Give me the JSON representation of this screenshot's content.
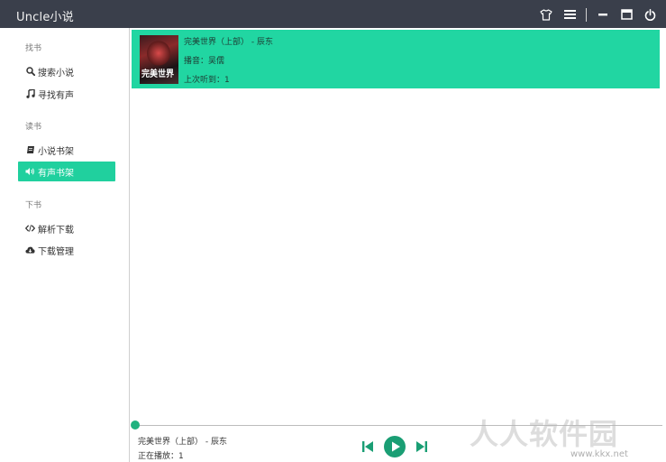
{
  "app": {
    "title": "Uncle小说"
  },
  "window_controls": [
    {
      "icon": "shirt-icon"
    },
    {
      "icon": "menu-icon"
    },
    {
      "icon": "minimize-icon"
    },
    {
      "icon": "maximize-icon"
    },
    {
      "icon": "power-icon"
    }
  ],
  "sidebar": {
    "groups": [
      {
        "label": "找书",
        "items": [
          {
            "label": "搜索小说",
            "icon": "search-icon"
          },
          {
            "label": "寻找有声",
            "icon": "music-note-icon"
          }
        ]
      },
      {
        "label": "读书",
        "items": [
          {
            "label": "小说书架",
            "icon": "book-icon"
          },
          {
            "label": "有声书架",
            "icon": "volume-icon",
            "active": true
          }
        ]
      },
      {
        "label": "下书",
        "items": [
          {
            "label": "解析下载",
            "icon": "code-icon"
          },
          {
            "label": "下载管理",
            "icon": "cloud-download-icon"
          }
        ]
      }
    ]
  },
  "bookshelf": {
    "items": [
      {
        "title": "完美世界（上部） - 辰东",
        "narrator": "播音：吴儒",
        "last_played": "上次听到：1",
        "cover_text": "完美世界"
      }
    ]
  },
  "player": {
    "track": "完美世界（上部） - 辰东",
    "status": "正在播放：1",
    "progress": 0.0
  },
  "colors": {
    "accent": "#21d6a2",
    "titlebar": "#3a3f4b",
    "active_nav": "#20d09e",
    "player_button": "#1a9e74"
  },
  "watermark": {
    "text": "人人软件园",
    "url": "www.kkx.net"
  }
}
